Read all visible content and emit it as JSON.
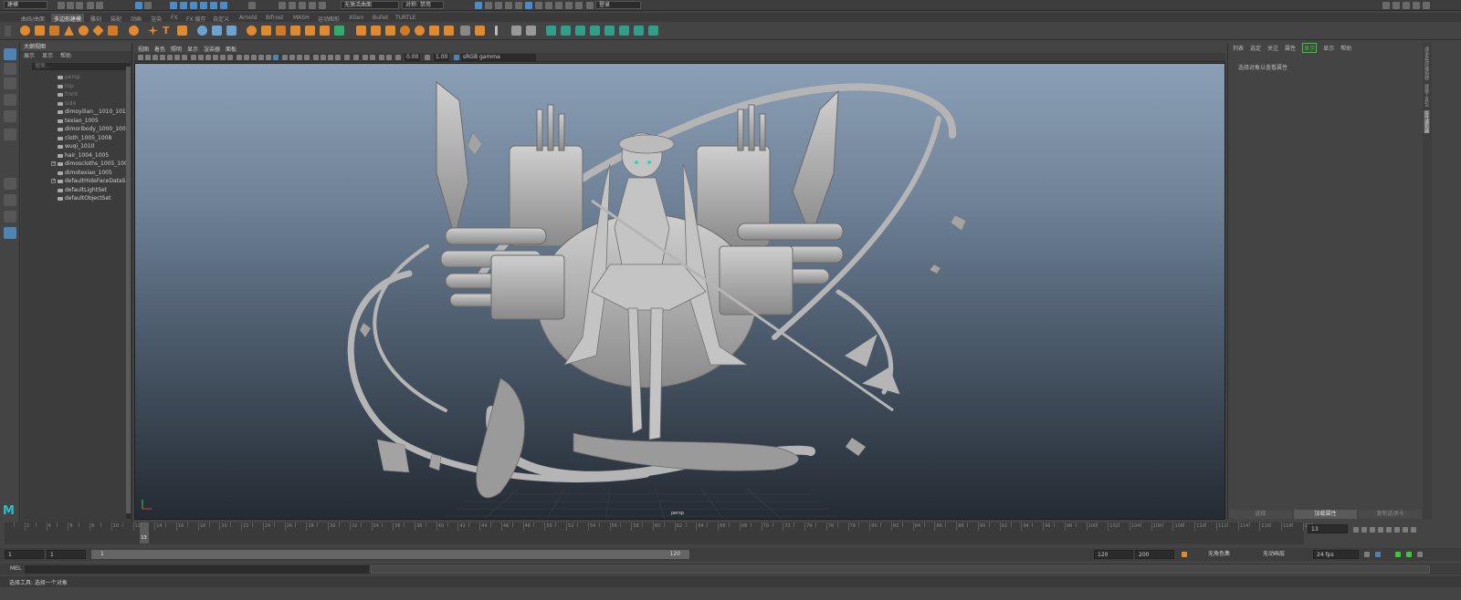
{
  "statusline": {
    "mode_menu": "建模",
    "live_surface": "无激活曲面",
    "symmetry_label": "对称: 禁用",
    "login": "登录"
  },
  "shelf_tabs": [
    "曲线/曲面",
    "多边形建模",
    "雕刻",
    "装配",
    "动画",
    "渲染",
    "FX",
    "FX 缓存",
    "自定义",
    "Arnold",
    "Bifrost",
    "MASH",
    "运动图形",
    "XGen",
    "Bullet",
    "TURTLE"
  ],
  "shelf_active_tab": "多边形建模",
  "outliner": {
    "title": "大纲视图",
    "menu": [
      "展示",
      "显示",
      "帮助"
    ],
    "search_placeholder": "搜索...",
    "items": [
      {
        "label": "persp",
        "dim": true
      },
      {
        "label": "top",
        "dim": true
      },
      {
        "label": "front",
        "dim": true
      },
      {
        "label": "side",
        "dim": true
      },
      {
        "label": "dimoyilian__1010_1013",
        "dim": false
      },
      {
        "label": "texiao_1005",
        "dim": false
      },
      {
        "label": "dimoribody_1000_1003",
        "dim": false
      },
      {
        "label": "cloth_1005_1008",
        "dim": false
      },
      {
        "label": "wuqi_1010",
        "dim": false
      },
      {
        "label": "hair_1004_1005",
        "dim": false
      },
      {
        "label": "dimoscloths_1005_1008",
        "dim": false
      },
      {
        "label": "dimotexiao_1005",
        "dim": false
      },
      {
        "label": "defaultHideFaceDataSet",
        "dim": false
      },
      {
        "label": "defaultLightSet",
        "dim": false
      },
      {
        "label": "defaultObjectSet",
        "dim": false
      }
    ]
  },
  "viewport": {
    "menu": [
      "视图",
      "着色",
      "照明",
      "显示",
      "渲染器",
      "面板"
    ],
    "exposure": "0.00",
    "gamma": "1.00",
    "colorspace": "sRGB gamma",
    "camera": "persp"
  },
  "attribute_editor": {
    "menu": [
      "列表",
      "选定",
      "关注",
      "属性",
      "显示",
      "显示",
      "帮助"
    ],
    "highlighted_menu": "显示",
    "message": "选择对象以查看属性",
    "buttons": [
      "选择",
      "加载属性",
      "复制选项卡"
    ]
  },
  "side_tabs": [
    "通道盒/层编辑器",
    "建模工具包",
    "属性编辑器"
  ],
  "timeline": {
    "ticks": [
      "2",
      "4",
      "6",
      "8",
      "10",
      "12",
      "14",
      "16",
      "18",
      "20",
      "22",
      "24",
      "26",
      "28",
      "30",
      "32",
      "34",
      "36",
      "38",
      "40",
      "42",
      "44",
      "46",
      "48",
      "50",
      "52",
      "54",
      "56",
      "58",
      "60",
      "62",
      "64",
      "66",
      "68",
      "70",
      "72",
      "74",
      "76",
      "78",
      "80",
      "82",
      "84",
      "86",
      "88",
      "90",
      "92",
      "94",
      "96",
      "98",
      "100",
      "102",
      "104",
      "106",
      "108",
      "110",
      "112",
      "114",
      "116",
      "118",
      "120"
    ],
    "current_frame": "13",
    "current_frame_field": "13"
  },
  "range": {
    "start": "1",
    "start2": "1",
    "slider_start": "1",
    "slider_end": "120",
    "end": "120",
    "end2": "200",
    "character_set": "无角色集",
    "anim_layer": "无动画层",
    "fps": "24 fps"
  },
  "command_line": {
    "label": "MEL"
  },
  "help_line": "选择工具: 选择一个对象",
  "colors": {
    "accent": "#4e84b4",
    "shelf_orange": "#e0892e",
    "shelf_teal": "#2f9e8a",
    "highlight_green": "#33cc33"
  }
}
